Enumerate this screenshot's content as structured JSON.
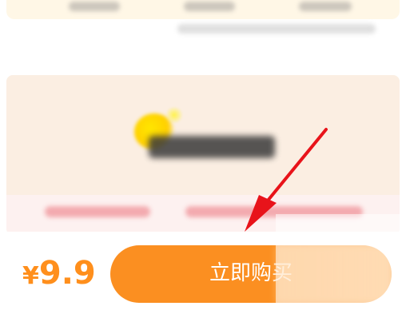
{
  "purchase_bar": {
    "price_symbol": "¥",
    "price_value": "9.9",
    "buy_label": "立即购买"
  },
  "colors": {
    "accent": "#fb8f21",
    "price": "#ff8f1c",
    "annotation": "#e8131a"
  },
  "icons": {
    "promo_logo": "lemon-logo-icon",
    "annotation": "red-arrow-icon"
  }
}
